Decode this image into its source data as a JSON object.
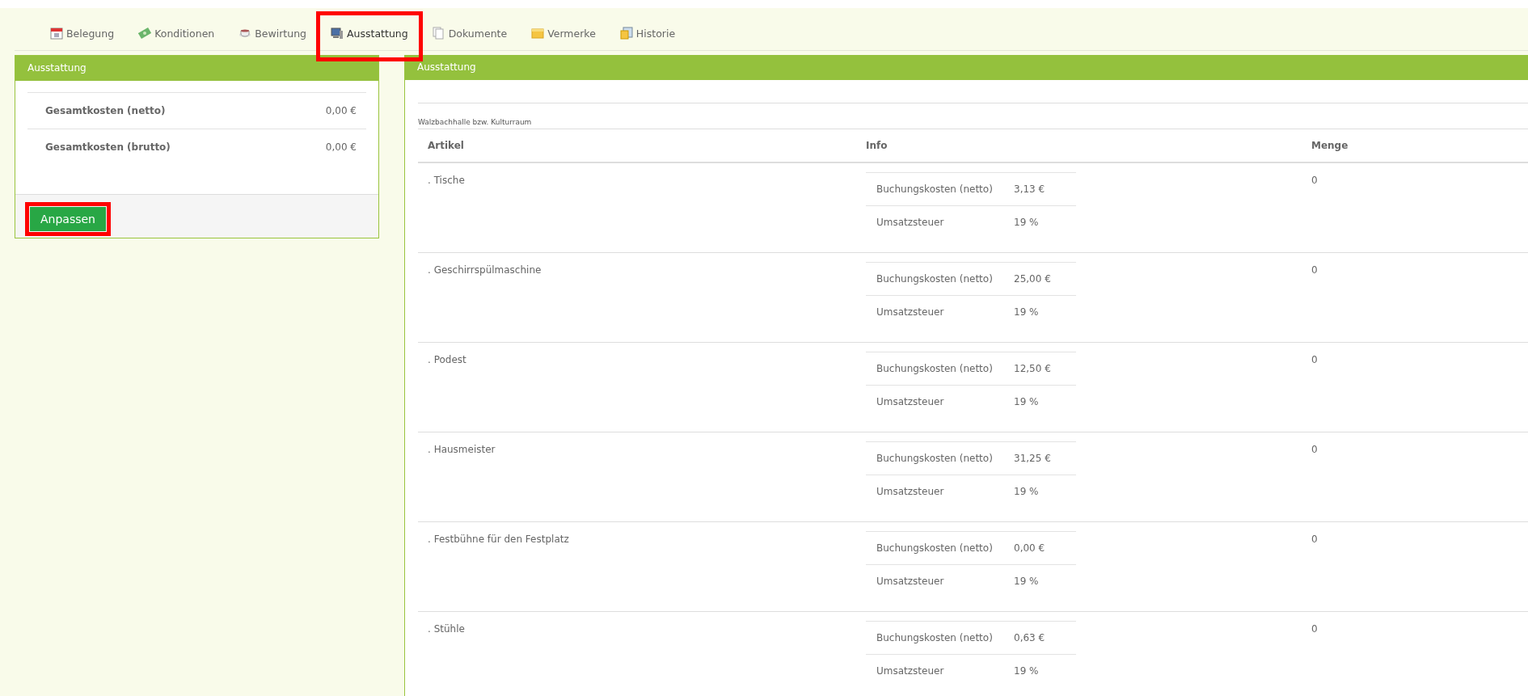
{
  "tabs": [
    {
      "label": "Belegung",
      "selected": false,
      "highlighted": false
    },
    {
      "label": "Konditionen",
      "selected": false,
      "highlighted": false
    },
    {
      "label": "Bewirtung",
      "selected": false,
      "highlighted": false
    },
    {
      "label": "Ausstattung",
      "selected": true,
      "highlighted": true
    },
    {
      "label": "Dokumente",
      "selected": false,
      "highlighted": false
    },
    {
      "label": "Vermerke",
      "selected": false,
      "highlighted": false
    },
    {
      "label": "Historie",
      "selected": false,
      "highlighted": false
    }
  ],
  "summary_panel": {
    "title": "Ausstattung",
    "rows": [
      {
        "label": "Gesamtkosten (netto)",
        "value": "0,00 €"
      },
      {
        "label": "Gesamtkosten (brutto)",
        "value": "0,00 €"
      }
    ],
    "button": {
      "label": "Anpassen",
      "highlighted": true
    }
  },
  "items_panel": {
    "title": "Ausstattung",
    "location": "Walzbachhalle bzw. Kulturraum",
    "columns": [
      "Artikel",
      "Info",
      "Menge"
    ],
    "rows": [
      {
        "article": ". Tische",
        "info": [
          {
            "label": "Buchungskosten (netto)",
            "value": "3,13 €"
          },
          {
            "label": "Umsatzsteuer",
            "value": "19 %"
          }
        ],
        "quantity": "0"
      },
      {
        "article": ". Geschirrspülmaschine",
        "info": [
          {
            "label": "Buchungskosten (netto)",
            "value": "25,00 €"
          },
          {
            "label": "Umsatzsteuer",
            "value": "19 %"
          }
        ],
        "quantity": "0"
      },
      {
        "article": ". Podest",
        "info": [
          {
            "label": "Buchungskosten (netto)",
            "value": "12,50 €"
          },
          {
            "label": "Umsatzsteuer",
            "value": "19 %"
          }
        ],
        "quantity": "0"
      },
      {
        "article": ". Hausmeister",
        "info": [
          {
            "label": "Buchungskosten (netto)",
            "value": "31,25 €"
          },
          {
            "label": "Umsatzsteuer",
            "value": "19 %"
          }
        ],
        "quantity": "0"
      },
      {
        "article": ". Festbühne für den Festplatz",
        "info": [
          {
            "label": "Buchungskosten (netto)",
            "value": "0,00 €"
          },
          {
            "label": "Umsatzsteuer",
            "value": "19 %"
          }
        ],
        "quantity": "0"
      },
      {
        "article": ". Stühle",
        "info": [
          {
            "label": "Buchungskosten (netto)",
            "value": "0,63 €"
          },
          {
            "label": "Umsatzsteuer",
            "value": "19 %"
          }
        ],
        "quantity": "0"
      }
    ]
  }
}
